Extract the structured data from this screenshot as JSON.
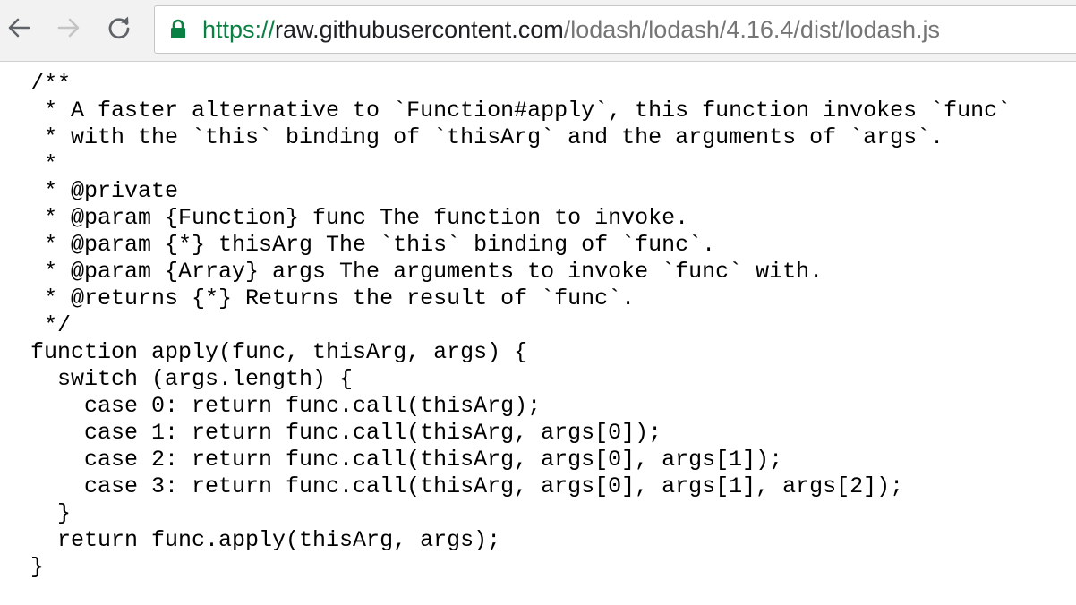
{
  "browser": {
    "url": {
      "scheme": "https://",
      "host": "raw.githubusercontent.com",
      "path": "/lodash/lodash/4.16.4/dist/lodash.js"
    },
    "colors": {
      "scheme": "#0b8043",
      "lock": "#0b8043",
      "host": "#202124",
      "path": "#757575",
      "toolbar_bg": "#f2f2f2"
    },
    "icons": {
      "back": "back-arrow-icon",
      "forward": "forward-arrow-icon",
      "reload": "reload-icon",
      "secure": "lock-icon"
    }
  },
  "code": {
    "lines": [
      "/**",
      " * A faster alternative to `Function#apply`, this function invokes `func`",
      " * with the `this` binding of `thisArg` and the arguments of `args`.",
      " *",
      " * @private",
      " * @param {Function} func The function to invoke.",
      " * @param {*} thisArg The `this` binding of `func`.",
      " * @param {Array} args The arguments to invoke `func` with.",
      " * @returns {*} Returns the result of `func`.",
      " */",
      "function apply(func, thisArg, args) {",
      "  switch (args.length) {",
      "    case 0: return func.call(thisArg);",
      "    case 1: return func.call(thisArg, args[0]);",
      "    case 2: return func.call(thisArg, args[0], args[1]);",
      "    case 3: return func.call(thisArg, args[0], args[1], args[2]);",
      "  }",
      "  return func.apply(thisArg, args);",
      "}"
    ]
  }
}
